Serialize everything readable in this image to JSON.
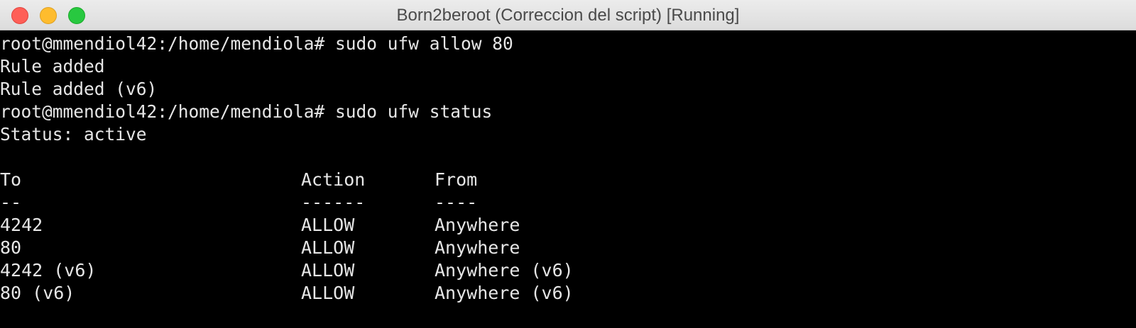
{
  "window": {
    "title": "Born2beroot (Correccion del script) [Running]"
  },
  "terminal": {
    "lines": [
      "root@mmendiol42:/home/mendiola# sudo ufw allow 80",
      "Rule added",
      "Rule added (v6)",
      "root@mmendiol42:/home/mendiola# sudo ufw status",
      "Status: active",
      ""
    ],
    "table": {
      "headers": [
        "To",
        "Action",
        "From"
      ],
      "separators": [
        "--",
        "------",
        "----"
      ],
      "rows": [
        [
          "4242",
          "ALLOW",
          "Anywhere"
        ],
        [
          "80",
          "ALLOW",
          "Anywhere"
        ],
        [
          "4242 (v6)",
          "ALLOW",
          "Anywhere (v6)"
        ],
        [
          "80 (v6)",
          "ALLOW",
          "Anywhere (v6)"
        ]
      ]
    }
  },
  "colors": {
    "terminal_bg": "#000000",
    "terminal_fg": "#e6e6e6",
    "close": "#fe5f57",
    "minimize": "#febc2e",
    "zoom": "#28c840"
  }
}
